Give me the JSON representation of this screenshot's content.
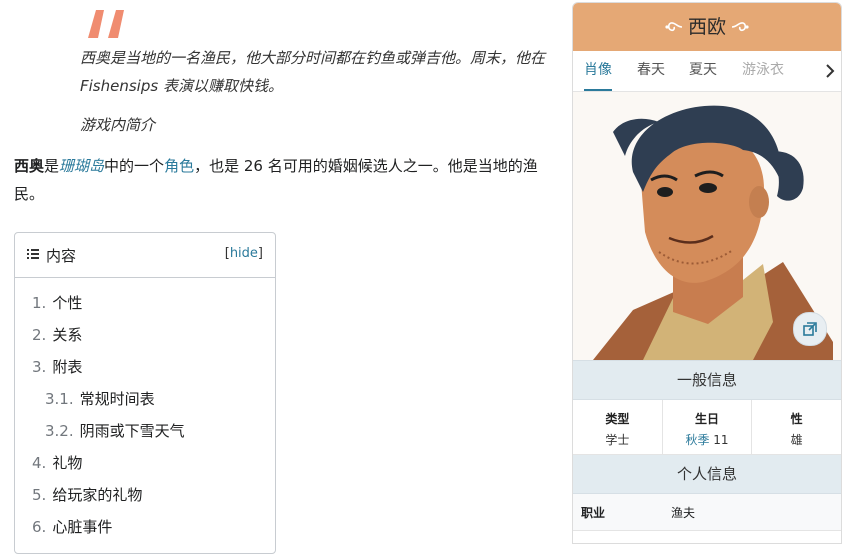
{
  "quote": {
    "text": "西奥是当地的一名渔民，他大部分时间都在钓鱼或弹吉他。周末，他在 Fishensips 表演以赚取快钱。",
    "source": "游戏内简介"
  },
  "intro": {
    "name": "西奥",
    "is": "是",
    "game_link": "珊瑚岛",
    "mid": "中的一个",
    "role_link": "角色",
    "rest": "，也是 26 名可用的婚姻候选人之一。他是当地的渔民。"
  },
  "toc": {
    "title": "内容",
    "hide_open": "[",
    "hide_label": "hide",
    "hide_close": "]",
    "items": [
      {
        "num": "1.",
        "label": "个性"
      },
      {
        "num": "2.",
        "label": "关系"
      },
      {
        "num": "3.",
        "label": "附表"
      },
      {
        "num": "3.1.",
        "label": "常规时间表"
      },
      {
        "num": "3.2.",
        "label": "阴雨或下雪天气"
      },
      {
        "num": "4.",
        "label": "礼物"
      },
      {
        "num": "5.",
        "label": "给玩家的礼物"
      },
      {
        "num": "6.",
        "label": "心脏事件"
      }
    ]
  },
  "infobox": {
    "title": "西欧",
    "tabs": [
      "肖像",
      "春天",
      "夏天",
      "游泳衣"
    ],
    "general_header": "一般信息",
    "type_label": "类型",
    "type_value": "学士",
    "birthday_label": "生日",
    "birthday_season": "秋季",
    "birthday_day": "11",
    "gender_label": "性",
    "gender_value": "雄",
    "personal_header": "个人信息",
    "job_label": "职业",
    "job_value": "渔夫"
  },
  "colors": {
    "accent": "#e5a875",
    "link": "#2b7a9b",
    "quote_mark": "#f08c70",
    "section_bg": "#e2ebf0"
  },
  "icons": [
    "quote-mark-icon",
    "list-icon",
    "chevron-right-icon",
    "expand-icon",
    "ornament-icon"
  ]
}
